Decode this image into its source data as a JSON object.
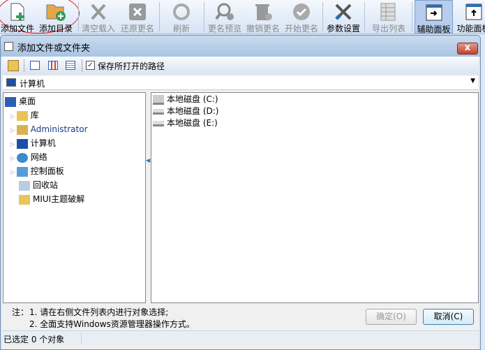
{
  "toolbar": {
    "items": [
      {
        "label": "添加文件",
        "icon": "add-file-icon"
      },
      {
        "label": "添加目录",
        "icon": "add-folder-icon"
      },
      {
        "label": "清空载入",
        "icon": "clear-icon"
      },
      {
        "label": "还原更名",
        "icon": "restore-icon"
      },
      {
        "label": "刷新",
        "icon": "refresh-icon"
      },
      {
        "label": "更名预览",
        "icon": "preview-icon"
      },
      {
        "label": "撤销更名",
        "icon": "undo-rename-icon"
      },
      {
        "label": "开始更名",
        "icon": "start-rename-icon"
      },
      {
        "label": "参数设置",
        "icon": "settings-icon"
      },
      {
        "label": "导出列表",
        "icon": "export-icon"
      },
      {
        "label": "辅助面板",
        "icon": "aux-panel-icon"
      },
      {
        "label": "功能面板",
        "icon": "function-panel-icon"
      }
    ]
  },
  "dialog": {
    "title": "添加文件或文件夹",
    "close": "x",
    "save_path_label": "保存所打开的路径",
    "address": "计算机",
    "tree": [
      {
        "label": "桌面"
      },
      {
        "label": "库"
      },
      {
        "label": "Administrator"
      },
      {
        "label": "计算机"
      },
      {
        "label": "网络"
      },
      {
        "label": "控制面板"
      },
      {
        "label": "回收站"
      },
      {
        "label": "MIUI主题破解"
      }
    ],
    "files": [
      {
        "label": "本地磁盘 (C:)"
      },
      {
        "label": "本地磁盘 (D:)"
      },
      {
        "label": "本地磁盘 (E:)"
      }
    ],
    "note_prefix": "注：",
    "note1": "1. 请在右侧文件列表内进行对象选择;",
    "note2": "2. 全面支持Windows资源管理器操作方式。",
    "ok": "确定(O)",
    "cancel": "取消(C)",
    "status": "已选定 0 个对象"
  }
}
